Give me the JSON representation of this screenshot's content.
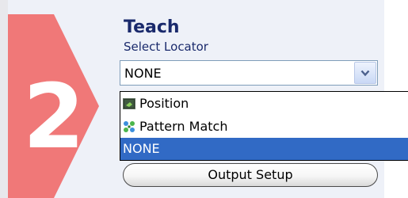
{
  "step": {
    "number": "2",
    "accent_color": "#f07878"
  },
  "teach": {
    "title": "Teach",
    "select_label": "Select Locator",
    "selected_value": "NONE",
    "options": [
      {
        "label": "Position",
        "icon": "position-icon"
      },
      {
        "label": "Pattern Match",
        "icon": "pattern-match-icon"
      },
      {
        "label": "NONE",
        "icon": ""
      }
    ],
    "highlighted_option": "NONE"
  },
  "output_setup": {
    "label": "Output Setup"
  },
  "colors": {
    "panel_background": "#eef1f8",
    "title_text": "#1a2a6c",
    "selection": "#316ac5"
  }
}
